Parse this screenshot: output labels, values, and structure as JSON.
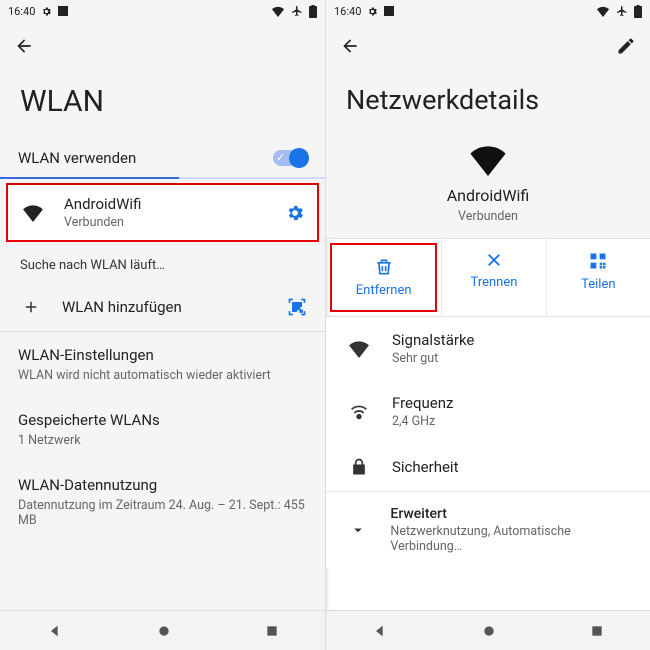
{
  "status": {
    "time": "16:40"
  },
  "left": {
    "title": "WLAN",
    "use_wlan": "WLAN verwenden",
    "network": {
      "name": "AndroidWifi",
      "status": "Verbunden"
    },
    "searching": "Suche nach WLAN läuft…",
    "add_network": "WLAN hinzufügen",
    "settings": {
      "title": "WLAN-Einstellungen",
      "sub": "WLAN wird nicht automatisch wieder aktiviert"
    },
    "saved": {
      "title": "Gespeicherte WLANs",
      "sub": "1 Netzwerk"
    },
    "usage": {
      "title": "WLAN-Datennutzung",
      "sub": "Datennutzung im Zeitraum 24. Aug. – 21. Sept.: 455 MB"
    }
  },
  "right": {
    "title": "Netzwerkdetails",
    "network": {
      "name": "AndroidWifi",
      "status": "Verbunden"
    },
    "actions": {
      "remove": "Entfernen",
      "disconnect": "Trennen",
      "share": "Teilen"
    },
    "signal": {
      "label": "Signalstärke",
      "value": "Sehr gut"
    },
    "freq": {
      "label": "Frequenz",
      "value": "2,4 GHz"
    },
    "security": {
      "label": "Sicherheit",
      "value": ""
    },
    "advanced": {
      "label": "Erweitert",
      "value": "Netzwerknutzung, Automatische Verbindung…"
    }
  }
}
